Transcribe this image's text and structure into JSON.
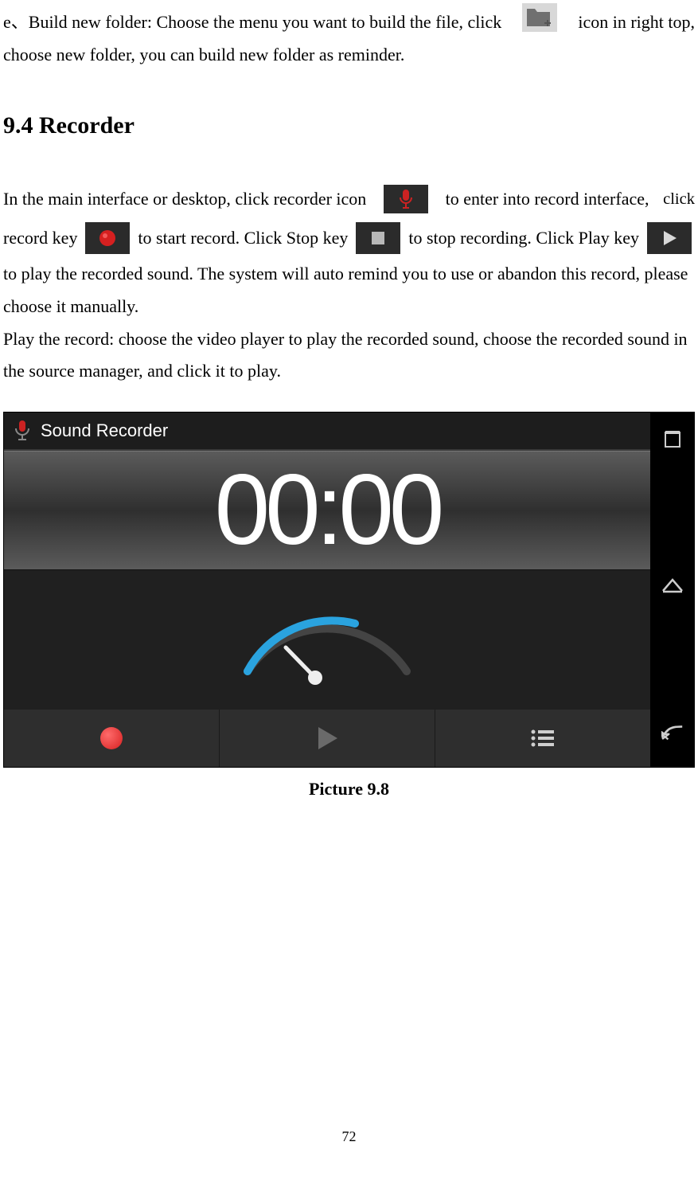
{
  "intro_item": {
    "prefix": "e、",
    "line1_left": "e、Build new folder: Choose the menu you want to build the file, click ",
    "line1_right": " icon in right top,",
    "line2": "choose new folder, you can build new folder as reminder."
  },
  "heading": "9.4 Recorder",
  "recorder_para": {
    "l1_left": "In the main interface or desktop, click recorder icon ",
    "l1_right": " to enter into record interface, ",
    "l1_tail": "click",
    "l2_a": "record key ",
    "l2_b": " to start record. Click Stop key ",
    "l2_c": " to stop recording. Click Play key ",
    "l3": "to play the recorded sound. The system will auto remind you to use or abandon this record, please",
    "l4": "choose it manually.",
    "l5": "Play the record: choose the video player to play the recorded sound, choose the recorded sound in",
    "l6": "the source manager, and click it to play."
  },
  "screenshot": {
    "app_title": "Sound Recorder",
    "timer": "00:00"
  },
  "caption": "Picture 9.8",
  "page_number": "72"
}
